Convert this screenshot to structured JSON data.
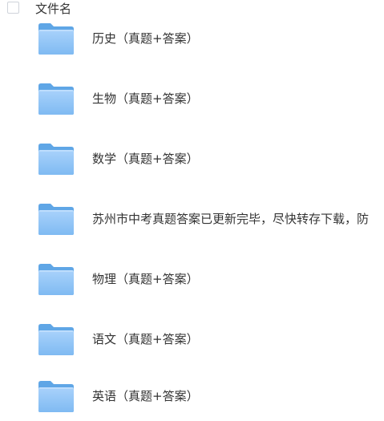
{
  "header": {
    "column_label": "文件名"
  },
  "files": [
    {
      "name": "历史（真题+答案）",
      "icon": "folder-icon"
    },
    {
      "name": "生物（真题+答案）",
      "icon": "folder-icon"
    },
    {
      "name": "数学（真题+答案）",
      "icon": "folder-icon"
    },
    {
      "name": "苏州市中考真题答案已更新完毕，尽快转存下载，防",
      "icon": "folder-icon"
    },
    {
      "name": "物理（真题+答案）",
      "icon": "folder-icon"
    },
    {
      "name": "语文（真题+答案）",
      "icon": "folder-icon"
    },
    {
      "name": "英语（真题+答案）",
      "icon": "folder-icon"
    }
  ],
  "colors": {
    "folder_back": "#5fa6e6",
    "folder_front_top": "#a9d2fb",
    "folder_front_bottom": "#7fbaf2",
    "text": "#333333"
  }
}
